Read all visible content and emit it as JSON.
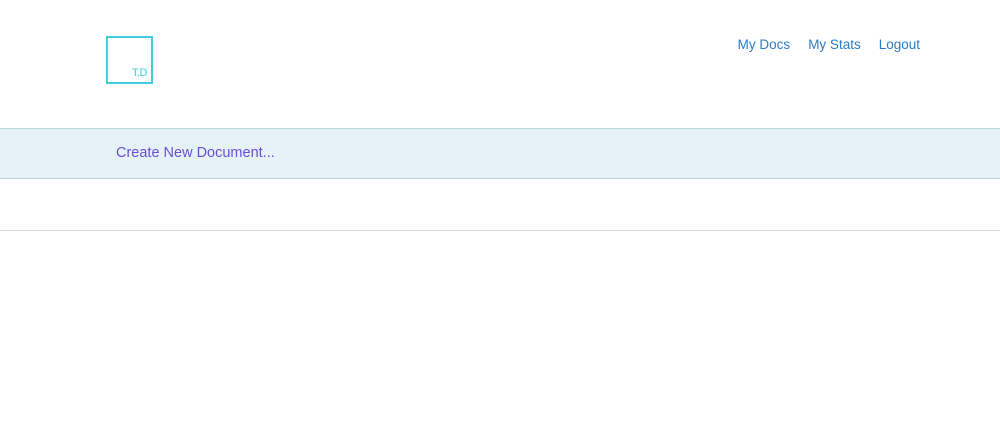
{
  "logo": {
    "text": "T.D"
  },
  "nav": {
    "items": [
      {
        "label": "My Docs"
      },
      {
        "label": "My Stats"
      },
      {
        "label": "Logout"
      }
    ]
  },
  "create_bar": {
    "label": "Create New Document..."
  },
  "colors": {
    "logo": "#3dcfe0",
    "nav_link": "#2a7cc7",
    "create_link": "#6a4fd8",
    "create_bar_bg": "#e5f3f8"
  }
}
